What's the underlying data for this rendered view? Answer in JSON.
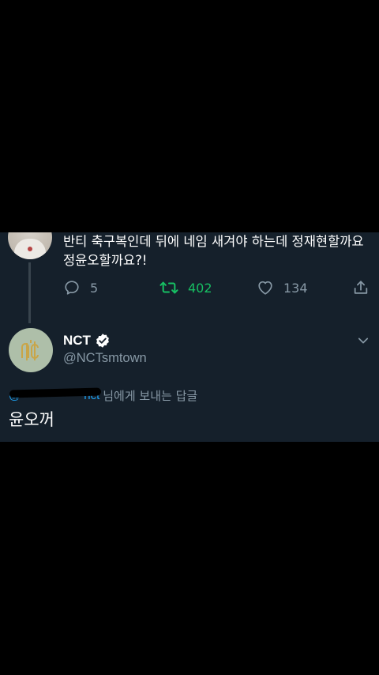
{
  "parent_tweet": {
    "text": "반티 축구복인데 뒤에 네임 새겨야 하는데 정재현할까요\n정윤오할까요?!",
    "reply_count": "5",
    "retweet_count": "402",
    "like_count": "134"
  },
  "reply_tweet": {
    "display_name": "NCT",
    "handle": "@NCTsmtown",
    "replying_to_mention": "@",
    "replying_to_mention_tail": "nct",
    "replying_to_suffix": "님에게 보내는 답글",
    "text": "윤오꺼"
  },
  "icons": {
    "reply": "reply-icon",
    "retweet": "retweet-icon",
    "like": "heart-icon",
    "share": "share-icon",
    "verified": "verified-badge-icon",
    "more": "chevron-down-icon"
  },
  "colors": {
    "background": "#15202b",
    "primary_text": "#ffffff",
    "secondary_text": "#8899a6",
    "retweet_active": "#17bf63",
    "link": "#1da1f2"
  }
}
